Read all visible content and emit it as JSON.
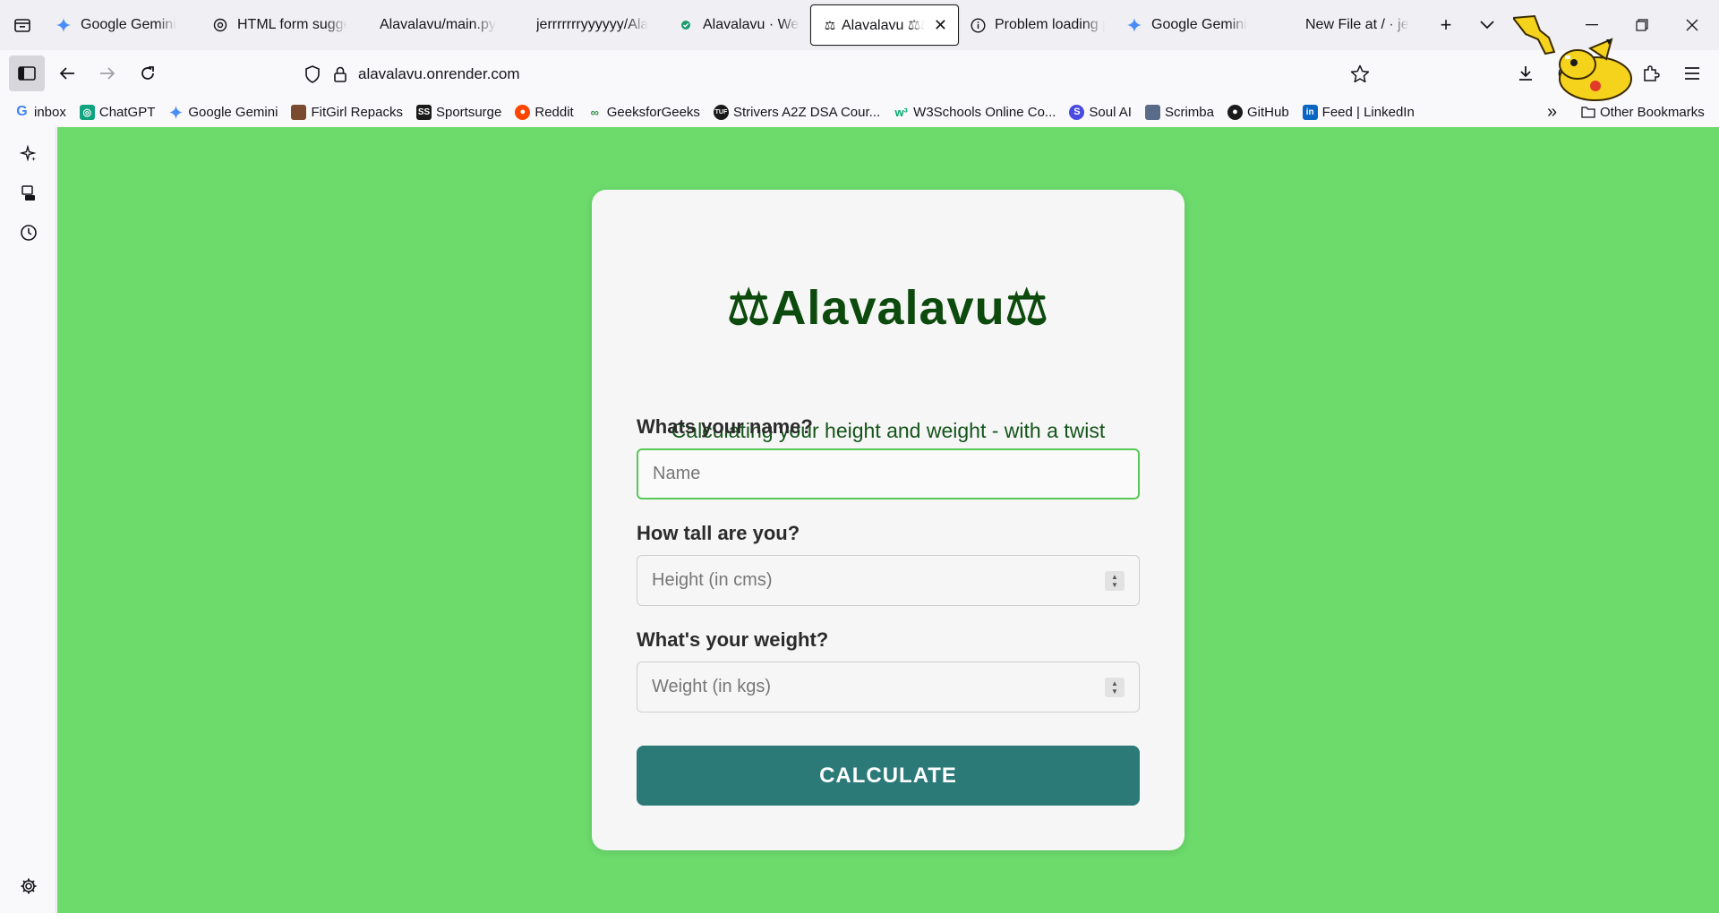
{
  "tabs": [
    {
      "label": "Google Gemini",
      "icon": "gemini-icon",
      "active": false
    },
    {
      "label": "HTML form sugge",
      "icon": "chatgpt-icon",
      "active": false
    },
    {
      "label": "Alavalavu/main.py",
      "icon": "none",
      "active": false
    },
    {
      "label": "jerrrrrrryyyyyy/Ala",
      "icon": "none",
      "active": false
    },
    {
      "label": "Alavalavu · Web",
      "icon": "render-check-icon",
      "active": false
    },
    {
      "label": "Alavalavu ⚖⚖",
      "icon": "scales-icon",
      "active": true
    },
    {
      "label": "Problem loading p",
      "icon": "info-icon",
      "active": false
    },
    {
      "label": "Google Gemini",
      "icon": "gemini-icon",
      "active": false
    },
    {
      "label": "New File at / · jerr",
      "icon": "none",
      "active": false
    }
  ],
  "navbar": {
    "url": "alavalavu.onrender.com"
  },
  "bookmarks": [
    {
      "label": "inbox",
      "icon": "google-icon"
    },
    {
      "label": "ChatGPT",
      "icon": "chatgpt-icon"
    },
    {
      "label": "Google Gemini",
      "icon": "gemini-icon"
    },
    {
      "label": "FitGirl Repacks",
      "icon": "fitgirl-icon"
    },
    {
      "label": "Sportsurge",
      "icon": "sportsurge-icon"
    },
    {
      "label": "Reddit",
      "icon": "reddit-icon"
    },
    {
      "label": "GeeksforGeeks",
      "icon": "gfg-icon"
    },
    {
      "label": "Strivers A2Z DSA Cour...",
      "icon": "tuf-icon"
    },
    {
      "label": "W3Schools Online Co...",
      "icon": "w3schools-icon"
    },
    {
      "label": "Soul AI",
      "icon": "soulai-icon"
    },
    {
      "label": "Scrimba",
      "icon": "scrimba-icon"
    },
    {
      "label": "GitHub",
      "icon": "github-icon"
    },
    {
      "label": "Feed | LinkedIn",
      "icon": "linkedin-icon"
    }
  ],
  "bookmarks_other": "Other Bookmarks",
  "page": {
    "title": "⚖Alavalavu⚖",
    "subtitle": "Calculating your height and weight - with a twist",
    "name_label": "Whats your name?",
    "name_placeholder": "Name",
    "height_label": "How tall are you?",
    "height_placeholder": "Height (in cms)",
    "weight_label": "What's your weight?",
    "weight_placeholder": "Weight (in kgs)",
    "button_label": "CALCULATE"
  },
  "colors": {
    "page_background": "#6cdb6c",
    "title_color": "#0d4a0d",
    "button_color": "#2b7a78",
    "focus_border": "#55c855"
  }
}
